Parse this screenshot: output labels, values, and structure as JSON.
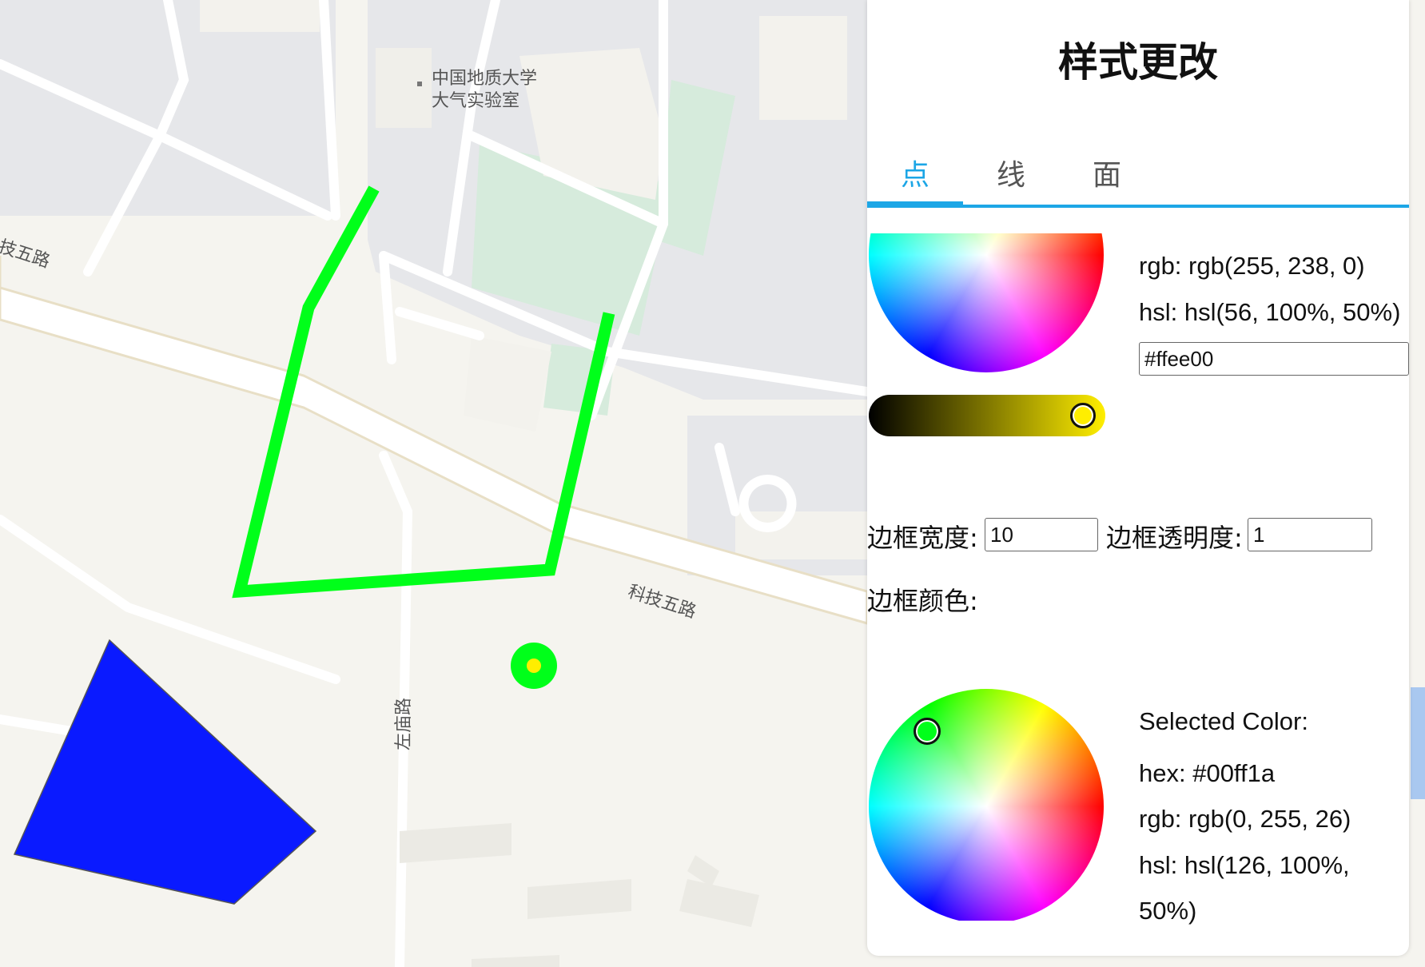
{
  "map": {
    "labels": {
      "poi_line1": "中国地质大学",
      "poi_line2": "大气实验室",
      "road_left": "技五路",
      "road_main": "科技五路",
      "road_vertical": "左庙路"
    },
    "features": {
      "line_color": "#00ff1a",
      "polygon_color": "#0a1aff",
      "point_outer_color": "#00ff1a",
      "point_inner_color": "#ffee00"
    }
  },
  "panel": {
    "title": "样式更改",
    "tabs": [
      "点",
      "线",
      "面"
    ],
    "active_tab": "点",
    "fill_picker": {
      "rgb_text": "rgb: rgb(255, 238, 0)",
      "hsl_text": "hsl: hsl(56, 100%, 50%)",
      "hex_value": "#ffee00"
    },
    "border_width_label": "边框宽度:",
    "border_width_value": "10",
    "border_opacity_label": "边框透明度:",
    "border_opacity_value": "1",
    "border_color_label": "边框颜色:",
    "border_picker": {
      "selected_label": "Selected Color:",
      "hex_text": "hex: #00ff1a",
      "rgb_text": "rgb: rgb(0, 255, 26)",
      "hsl_line1": "hsl: hsl(126, 100%,",
      "hsl_line2": "50%)"
    },
    "accent_color": "#1ca6e6"
  }
}
